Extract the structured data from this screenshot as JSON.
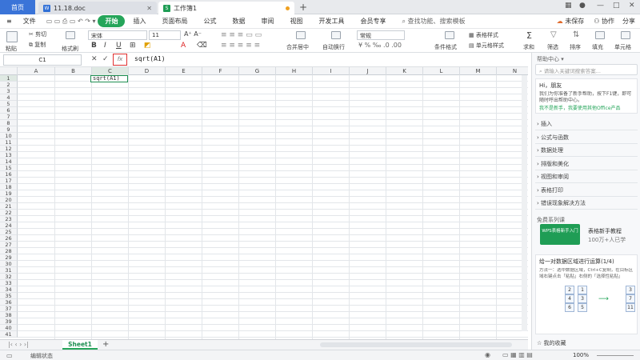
{
  "titlebar": {
    "home_tab": "首页",
    "doc_tab": "11.18.doc",
    "xls_tab": "工作簿1",
    "doc_icon": "W",
    "xls_icon": "S"
  },
  "menu": {
    "items": [
      "文件",
      "开始",
      "插入",
      "页面布局",
      "公式",
      "数据",
      "审阅",
      "视图",
      "开发工具",
      "会员专享"
    ],
    "active": "开始",
    "search": "查找功能、搜索模板",
    "sync": "未保存",
    "collab": "协作",
    "share": "分享"
  },
  "ribbon": {
    "cut": "剪切",
    "copy": "复制",
    "paste": "粘贴",
    "format_painter": "格式刷",
    "font_name": "宋体",
    "font_size": "11",
    "bold": "B",
    "italic": "I",
    "underline": "U",
    "merge_center": "合并居中",
    "wrap": "自动换行",
    "number_format": "常规",
    "cond_format": "条件格式",
    "table_style": "表格样式",
    "cell_style": "单元格样式",
    "sum": "求和",
    "filter": "筛选",
    "sort": "排序",
    "fill": "填充",
    "cell": "单元格"
  },
  "formulabar": {
    "namebox": "C1",
    "fx": "fx",
    "formula": "sqrt(A1)"
  },
  "grid": {
    "columns": [
      "A",
      "B",
      "C",
      "D",
      "E",
      "F",
      "G",
      "H",
      "I",
      "J",
      "K",
      "L",
      "M",
      "N"
    ],
    "rows": [
      "1",
      "2",
      "3",
      "4",
      "5",
      "6",
      "7",
      "8",
      "9",
      "10",
      "11",
      "12",
      "13",
      "14",
      "15",
      "16",
      "17",
      "18",
      "19",
      "20",
      "21",
      "22",
      "23",
      "24",
      "25",
      "26",
      "27",
      "28",
      "29",
      "30",
      "31",
      "32",
      "33",
      "34",
      "35",
      "36",
      "37",
      "38",
      "39",
      "40",
      "41"
    ],
    "active_cell_text": "sqrt(A1)"
  },
  "sheets": {
    "tabs": [
      "Sheet1"
    ],
    "add": "+"
  },
  "status": {
    "mode": "编辑状态",
    "zoom": "100%"
  },
  "sidepanel": {
    "title": "帮助中心",
    "search_placeholder": "请输入关键词搜索答案...",
    "greeting": "Hi，朋友",
    "greeting_body": "我们为你准备了新手帮助，按下F1键，即可随时呼出帮助中心。",
    "link_1": "我不是新手，我要使用其他Office产品",
    "categories": [
      "插入",
      "公式与函数",
      "数据处理",
      "排版和美化",
      "视图和审阅",
      "表格打印",
      "错误现象解决方法"
    ],
    "free_course": "免费系列课",
    "course_title": "表格新手教程",
    "course_count": "100万+人已学",
    "course_badge": "WPS表格新手入门",
    "tip_title": "给一对数据区域进行运算(1/4)",
    "tip_body": "方法一：选中数据区域，Ctrl+C复制，在目标区域右键点击「粘贴」右侧的「选择性粘贴」",
    "favorite": "我的收藏",
    "diagram_left": [
      "2",
      "4",
      "6"
    ],
    "diagram_mid": [
      "1",
      "3",
      "5"
    ],
    "diagram_right": [
      "3",
      "7",
      "11"
    ]
  },
  "colors": {
    "accent_green": "#25a55a",
    "tab_blue": "#3a74d8",
    "fx_highlight": "#e03030"
  }
}
